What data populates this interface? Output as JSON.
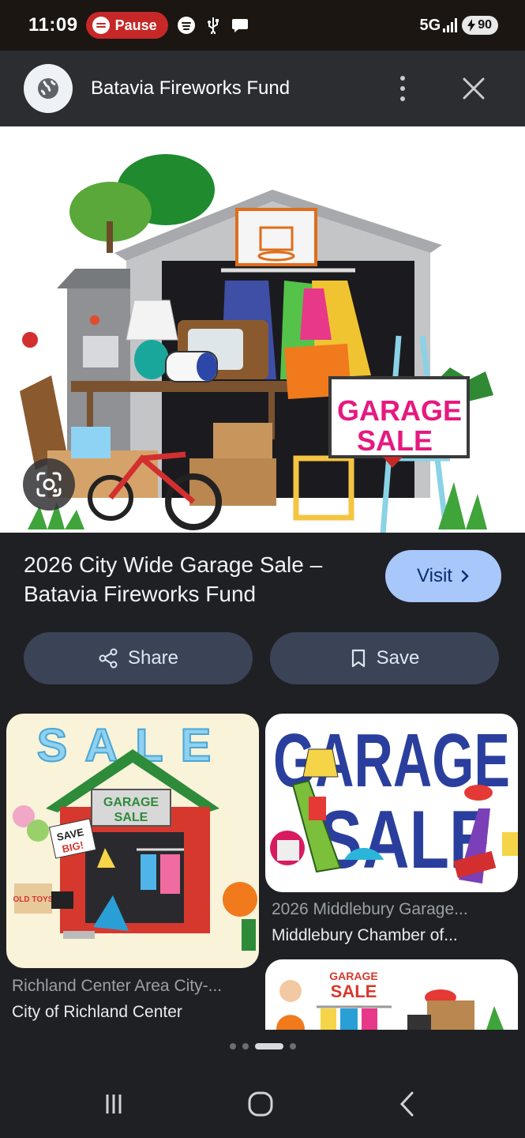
{
  "status_bar": {
    "time": "11:09",
    "pause_label": "Pause",
    "network": "5G",
    "battery": "90",
    "icons": [
      "spotify-icon",
      "usb-icon",
      "chat-icon",
      "signal-icon",
      "battery-icon"
    ]
  },
  "header": {
    "site_title": "Batavia Fireworks Fund",
    "icons": [
      "globe-icon",
      "more-vert-icon",
      "close-icon"
    ]
  },
  "hero": {
    "sign_line1": "GARAGE",
    "sign_line2": "SALE",
    "lens_icon": "google-lens-icon"
  },
  "result": {
    "title": "2026 City Wide Garage Sale – Batavia Fireworks Fund",
    "visit_label": "Visit",
    "share_label": "Share",
    "save_label": "Save"
  },
  "related": [
    {
      "title": "Richland Center Area City-...",
      "source": "City of Richland Center",
      "art_top": "SALE",
      "art_sign1": "GARAGE",
      "art_sign2": "SALE",
      "art_badge1": "SAVE",
      "art_badge2": "BIG!",
      "art_box": "OLD TOYS"
    },
    {
      "title": "2026 Middlebury Garage...",
      "source": "Middlebury Chamber of...",
      "art_line1": "GARAGE",
      "art_line2": "SALE"
    },
    {
      "art_line1": "GARAGE",
      "art_line2": "SALE"
    }
  ],
  "colors": {
    "background": "#1f2024",
    "visit_button": "#a8c7fa",
    "action_button": "#3b4456",
    "pause_pill": "#c62828",
    "sign_magenta": "#e6197f"
  }
}
